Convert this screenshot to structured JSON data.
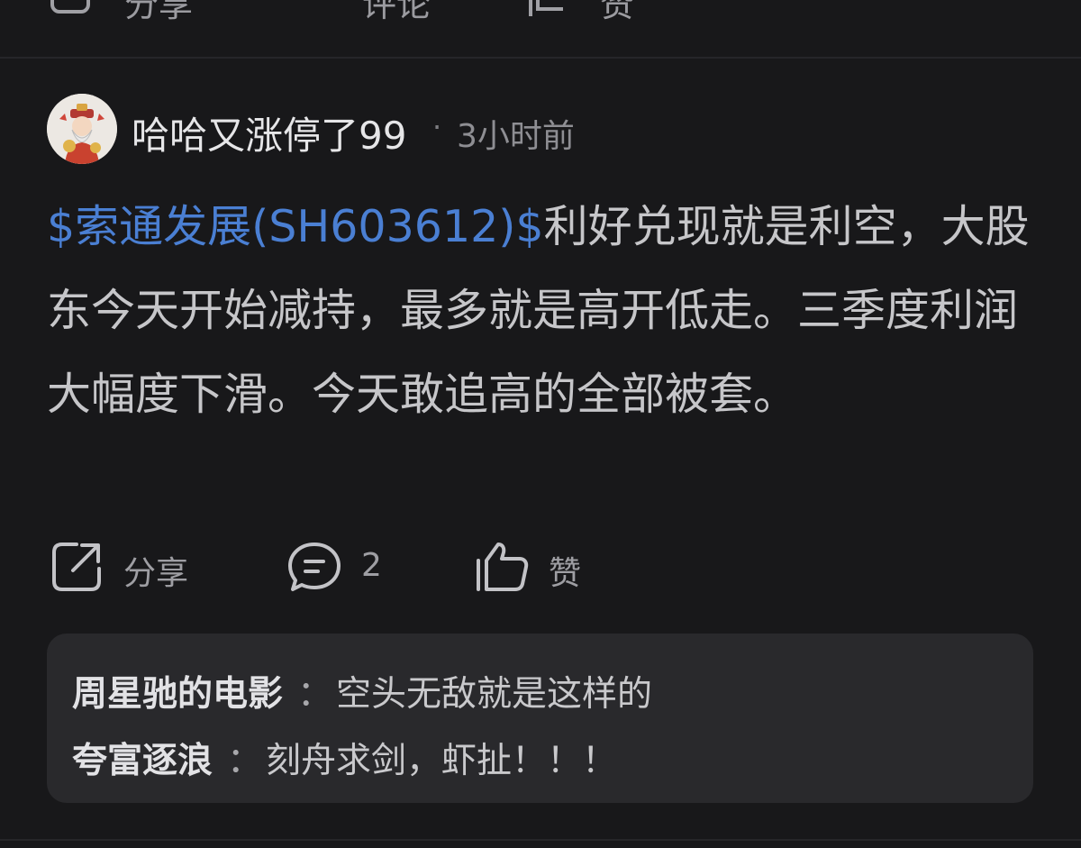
{
  "top_actions": {
    "share_label": "分享",
    "comment_label": "评论",
    "like_label": "赞"
  },
  "post": {
    "author": "哈哈又涨停了99",
    "separator": "·",
    "time": "3小时前",
    "stock_tag": "$索通发展(SH603612)$",
    "text": "利好兑现就是利空，大股东今天开始减持，最多就是高开低走。三季度利润大幅度下滑。今天敢追高的全部被套。"
  },
  "actions": {
    "share_label": "分享",
    "comment_count": "2",
    "like_label": "赞"
  },
  "comments": [
    {
      "name": "周星驰的电影",
      "sep": "：",
      "text": "空头无敌就是这样的"
    },
    {
      "name": "夸富逐浪",
      "sep": "：",
      "text": "刻舟求剑，虾扯！！！"
    }
  ],
  "colors": {
    "background": "#18181a",
    "stock_link": "#4a7fd3",
    "comment_box": "#29292c"
  }
}
